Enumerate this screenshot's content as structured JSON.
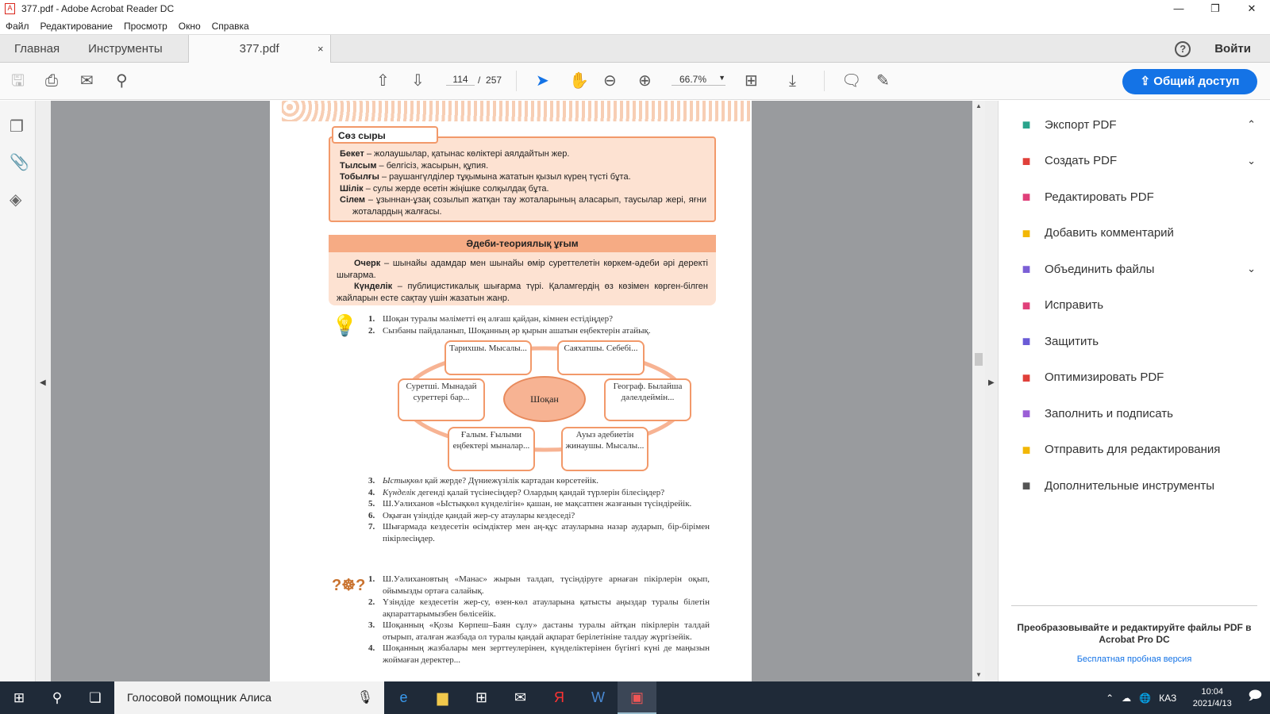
{
  "window": {
    "title": "377.pdf - Adobe Acrobat Reader DC",
    "controls": [
      "—",
      "❐",
      "✕"
    ]
  },
  "menu": [
    "Файл",
    "Редактирование",
    "Просмотр",
    "Окно",
    "Справка"
  ],
  "tabs": {
    "home": "Главная",
    "tools": "Инструменты",
    "doc": "377.pdf",
    "close": "×",
    "help": "?",
    "login": "Войти"
  },
  "toolbar": {
    "page_current": "114",
    "page_sep": "/",
    "page_total": "257",
    "zoom": "66.7%",
    "share": "Общий доступ"
  },
  "page": {
    "vocab_title": "Сөз сыры",
    "vocab": [
      {
        "term": "Бекет",
        "def": " – жолаушылар, қатынас көліктері аялдайтын жер."
      },
      {
        "term": "Тылсым",
        "def": " – белгісіз, жасырын, құпия."
      },
      {
        "term": "Тобылғы",
        "def": " – раушангүлділер тұқымына жататын қызыл күрең түсті бұта."
      },
      {
        "term": "Шілік",
        "def": " –  сулы жерде өсетін жіңішке солқылдақ бұта."
      },
      {
        "term": "Сілем",
        "def": " – ұзыннан-ұзақ созылып жатқан тау жоталарының аласарып, таусылар жері, яғни жоталардың жалғасы."
      }
    ],
    "theory_title": "Әдеби-теориялық ұғым",
    "theory": [
      {
        "term": "Очерк",
        "def": " – шынайы адамдар мен шынайы өмір суреттелетін көркем-әдеби әрі деректі шығарма."
      },
      {
        "term": "Күнделік",
        "def": " – публицистикалық шығарма түрі. Қаламгердің өз көзімен көрген-білген жайларын есте сақтау үшін жазатын жанр."
      }
    ],
    "questions_a": [
      {
        "n": "1.",
        "t": "Шоқан туралы мәліметті ең алғаш қайдан, кімнен естідіңдер?"
      },
      {
        "n": "2.",
        "t": "Сызбаны пайдаланып, Шоқанның әр қырын ашатын еңбектерін атайық."
      }
    ],
    "diagram": {
      "center": "Шоқан",
      "nodes": [
        "Тарихшы. Мысалы...",
        "Саяхатшы. Себебі...",
        "Суретші. Мынадай суреттері бар...",
        "Географ. Былайша дәлелдеймін...",
        "Ғалым. Ғылыми еңбектері мыналар...",
        "Ауыз әдебиетін жинаушы. Мысалы..."
      ]
    },
    "questions_b": [
      {
        "n": "3.",
        "it": "Ыстықкөл",
        "t": " қай жерде? Дүниежүзілік картадан көрсетейік."
      },
      {
        "n": "4.",
        "it": "Күнделік",
        "t": " дегенді қалай түсінесіңдер? Олардың қандай түрлерін білесіңдер?"
      },
      {
        "n": "5.",
        "it": "",
        "t": "Ш.Уәлиханов «Ыстықкөл күнделігін» қашан, не мақсатпен жазғанын түсіндірейік."
      },
      {
        "n": "6.",
        "it": "",
        "t": "Оқыған үзіндіде қандай жер-су атаулары кездеседі?"
      },
      {
        "n": "7.",
        "it": "",
        "t": "Шығармада кездесетін өсімдіктер мен аң-құс атауларына назар аударып, бір-бірімен пікірлесіңдер."
      }
    ],
    "questions_c": [
      {
        "n": "1.",
        "t": "Ш.Уәлихановтың «Манас» жырын талдап, түсіндіруге арнаған пікірлерін оқып, ойымызды ортаға салайық."
      },
      {
        "n": "2.",
        "t": "Үзіндіде кездесетін жер-су, өзен-көл атауларына қатысты аңыздар туралы білетін ақпараттарымызбен бөлісейік."
      },
      {
        "n": "3.",
        "t": "Шоқанның «Қозы Көрпеш–Баян сұлу» дастаны туралы айтқан пікірлерін талдай отырып, аталған жазбада ол туралы қандай ақпарат берілетініне талдау жүргізейік."
      },
      {
        "n": "4.",
        "t": "Шоқанның жазбалары мен зерттеулерінен, күнделіктерінен бүгінгі күні де маңызын жоймаған деректер..."
      }
    ]
  },
  "right_panel": {
    "items": [
      {
        "label": "Экспорт PDF",
        "icon": "export-pdf-icon",
        "color": "#2aa48c",
        "chev": "⌃"
      },
      {
        "label": "Создать PDF",
        "icon": "create-pdf-icon",
        "color": "#e0403a",
        "chev": "⌄"
      },
      {
        "label": "Редактировать PDF",
        "icon": "edit-pdf-icon",
        "color": "#e0407a",
        "chev": ""
      },
      {
        "label": "Добавить комментарий",
        "icon": "comment-icon",
        "color": "#f2b705",
        "chev": ""
      },
      {
        "label": "Объединить файлы",
        "icon": "combine-icon",
        "color": "#7b5fd6",
        "chev": "⌄"
      },
      {
        "label": "Исправить",
        "icon": "redact-icon",
        "color": "#e0407a",
        "chev": ""
      },
      {
        "label": "Защитить",
        "icon": "shield-icon",
        "color": "#6a5bd6",
        "chev": ""
      },
      {
        "label": "Оптимизировать PDF",
        "icon": "optimize-icon",
        "color": "#e0403a",
        "chev": ""
      },
      {
        "label": "Заполнить и подписать",
        "icon": "sign-icon",
        "color": "#9b5fd6",
        "chev": ""
      },
      {
        "label": "Отправить для редактирования",
        "icon": "send-icon",
        "color": "#f2b705",
        "chev": ""
      },
      {
        "label": "Дополнительные инструменты",
        "icon": "more-tools-icon",
        "color": "#555555",
        "chev": ""
      }
    ],
    "promo": "Преобразовывайте и редактируйте файлы PDF в Acrobat Pro DC",
    "trial": "Бесплатная пробная версия"
  },
  "taskbar": {
    "search": "Голосовой помощник Алиса",
    "lang": "КАЗ",
    "time": "10:04",
    "date": "2021/4/13"
  },
  "colors": {
    "accent": "#1473e6",
    "vocab_bg": "#fde2d2",
    "vocab_border": "#f2996a",
    "taskbar": "#1f2a38"
  }
}
